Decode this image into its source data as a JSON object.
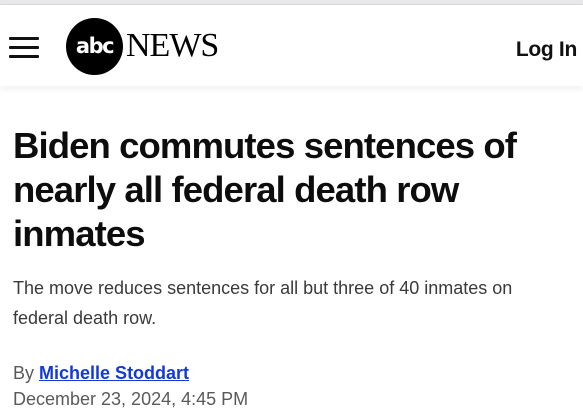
{
  "header": {
    "logo_abc": "abc",
    "logo_news": "NEWS",
    "login_label": "Log In",
    "menu_icon": "hamburger-menu-icon"
  },
  "article": {
    "headline": "Biden commutes sentences of nearly all federal death row inmates",
    "dek": "The move reduces sentences for all but three of 40 inmates on federal death row.",
    "byline_prefix": "By",
    "author": "Michelle Stoddart",
    "timestamp": "December 23, 2024, 4:45 PM"
  },
  "colors": {
    "author_link": "#1339d8",
    "logo_circle": "#000000",
    "text": "#0d0d0d"
  }
}
